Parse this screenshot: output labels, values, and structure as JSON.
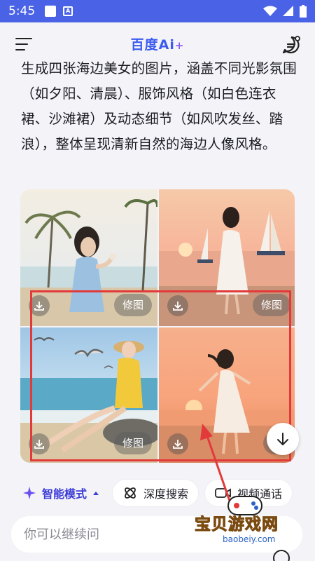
{
  "status_bar": {
    "time": "5:45"
  },
  "header": {
    "logo_text": "百度",
    "logo_ai": "Ai",
    "logo_plus": "+"
  },
  "answer": {
    "text": "生成四张海边美女的图片，涵盖不同光影氛围（如夕阳、清晨）、服饰风格（如白色连衣裙、沙滩裙）及动态细节（如风吹发丝、踏浪），整体呈现清新自然的海边人像风格。"
  },
  "images": [
    {
      "edit_label": "修图"
    },
    {
      "edit_label": "修图"
    },
    {
      "edit_label": "修图"
    },
    {
      "edit_label": "修"
    }
  ],
  "toolbar": {
    "mode_label": "智能模式",
    "deep_search_label": "深度搜索",
    "video_call_label": "视频通话"
  },
  "input": {
    "placeholder": "你可以继续问"
  },
  "watermark": {
    "text": "宝贝游戏网",
    "domain": "baobeiy.com"
  },
  "colors": {
    "accent": "#3b5bf0",
    "status_bar": "#4a63e6",
    "highlight_box": "#e23a3a"
  }
}
